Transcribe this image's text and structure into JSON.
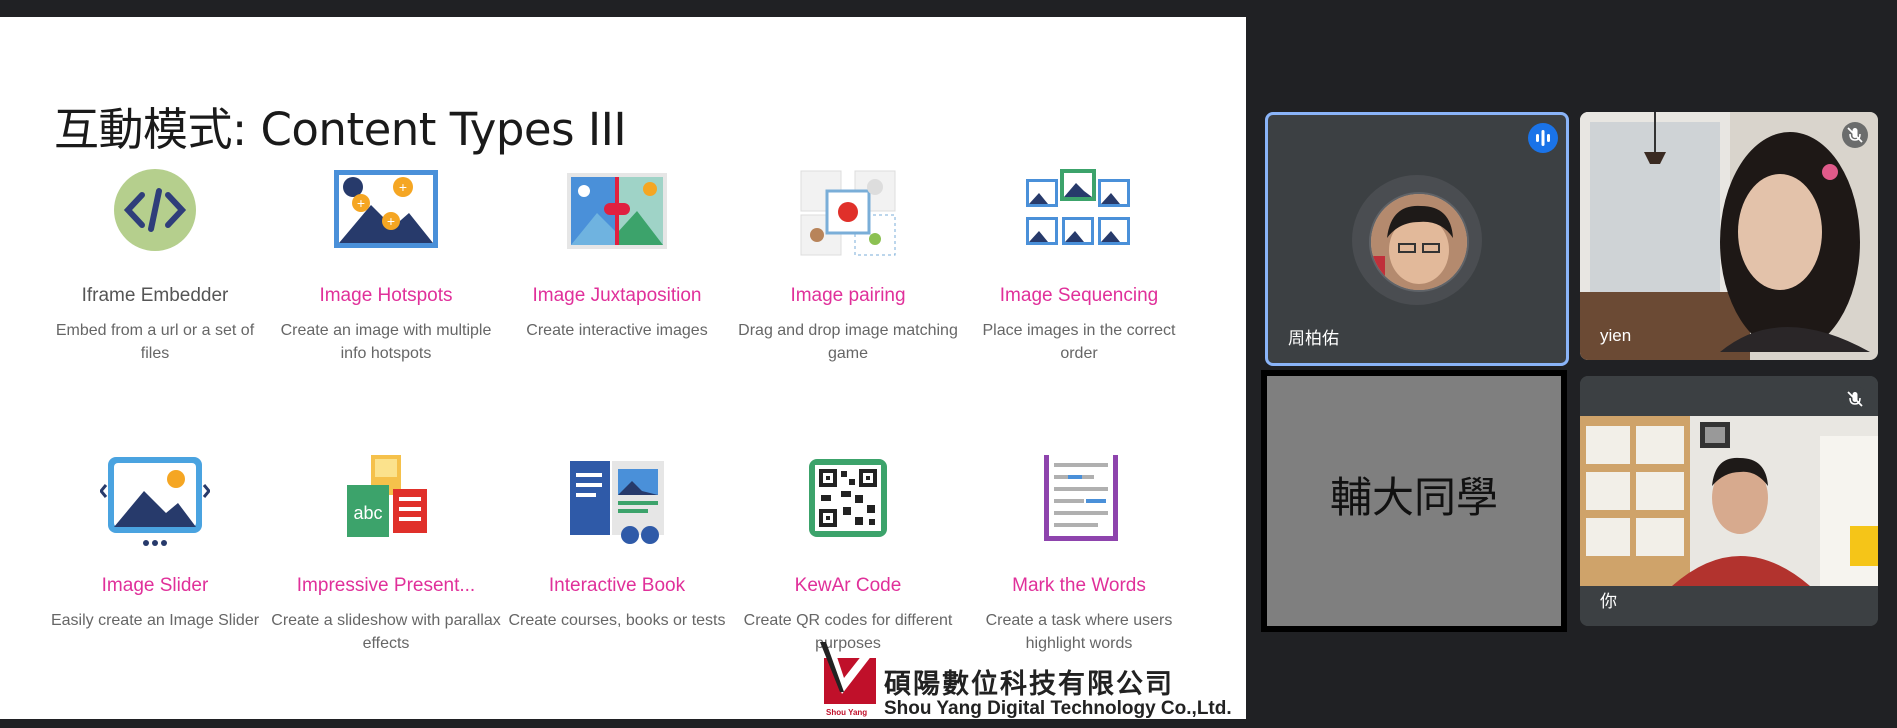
{
  "slide": {
    "title": "互動模式: Content Types III",
    "items": [
      {
        "name": "Iframe Embedder",
        "desc": "Embed from a url or a set of files"
      },
      {
        "name": "Image Hotspots",
        "desc": "Create an image with multiple info hotspots"
      },
      {
        "name": "Image Juxtaposition",
        "desc": "Create interactive images"
      },
      {
        "name": "Image pairing",
        "desc": "Drag and drop image matching game"
      },
      {
        "name": "Image Sequencing",
        "desc": "Place images in the correct order"
      },
      {
        "name": "Image Slider",
        "desc": "Easily create an Image Slider"
      },
      {
        "name": "Impressive Present...",
        "desc": "Create a slideshow with parallax effects"
      },
      {
        "name": "Interactive Book",
        "desc": "Create courses, books or tests"
      },
      {
        "name": "KewAr Code",
        "desc": "Create QR codes for different purposes"
      },
      {
        "name": "Mark the Words",
        "desc": "Create a task where users highlight words"
      }
    ],
    "logo": {
      "company_cn": "碩陽數位科技有限公司",
      "company_en": "Shou Yang Digital Technology Co.,Ltd.",
      "mark_text": "Shou Yang"
    },
    "colors": {
      "accent": "#e0309a",
      "title": "#1a1a1a"
    }
  },
  "meeting": {
    "participants": [
      {
        "name": "周柏佑",
        "state": "speaking"
      },
      {
        "name": "yien",
        "state": "muted"
      },
      {
        "name": "",
        "tile_label": "輔大同學"
      },
      {
        "name": "你",
        "state": "muted"
      }
    ],
    "colors": {
      "tile_bg": "#3c4043",
      "active_border": "#8ab4f8",
      "speaking": "#1a73e8"
    }
  }
}
